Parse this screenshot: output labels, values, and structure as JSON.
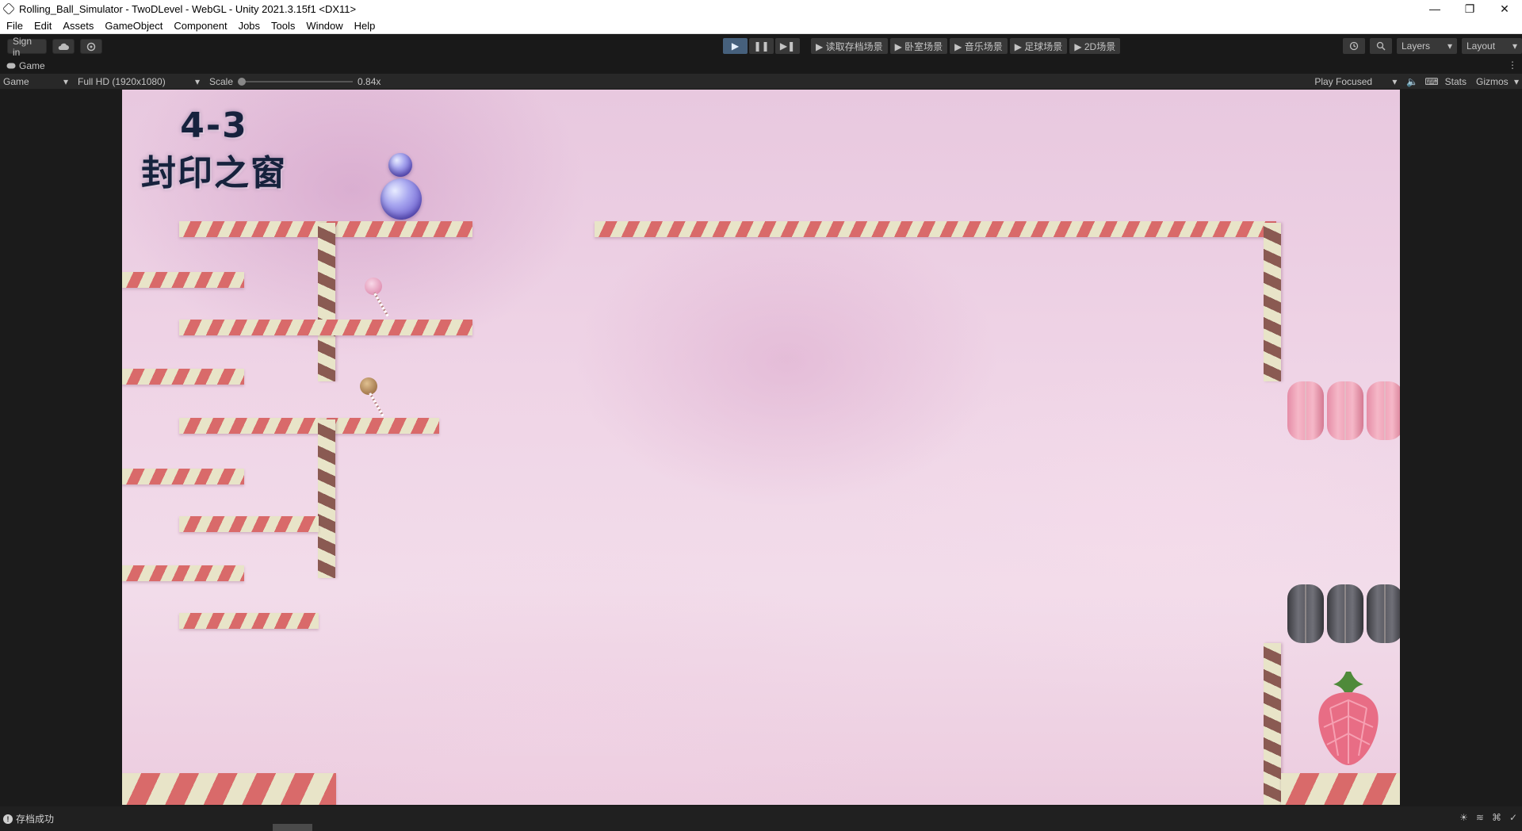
{
  "window": {
    "title": "Rolling_Ball_Simulator - TwoDLevel - WebGL - Unity 2021.3.15f1 <DX11>",
    "controls": [
      "—",
      "❐",
      "✕"
    ]
  },
  "menu": [
    "File",
    "Edit",
    "Assets",
    "GameObject",
    "Component",
    "Jobs",
    "Tools",
    "Window",
    "Help"
  ],
  "toolbar": {
    "sign_in": "Sign in",
    "play_controls": [
      "▶",
      "❚❚",
      "▶❚"
    ],
    "scene_buttons": [
      "▶ 读取存档场景",
      "▶ 卧室场景",
      "▶ 音乐场景",
      "▶ 足球场景",
      "▶ 2D场景"
    ],
    "layers": "Layers",
    "layout": "Layout"
  },
  "game_tab": {
    "label": "Game",
    "display": "Game",
    "resolution": "Full HD (1920x1080)",
    "scale_label": "Scale",
    "scale_value": "0.84x",
    "play_mode": "Play Focused",
    "stats": "Stats",
    "gizmos": "Gizmos"
  },
  "level": {
    "number": "4-3",
    "name": "封印之窗"
  },
  "status": {
    "message": "存档成功"
  },
  "colors": {
    "stripe_red": "#d96a6a",
    "stripe_cream": "#e8e4c8",
    "pole_brown": "#8a5a52",
    "play_active": "#46607c"
  }
}
